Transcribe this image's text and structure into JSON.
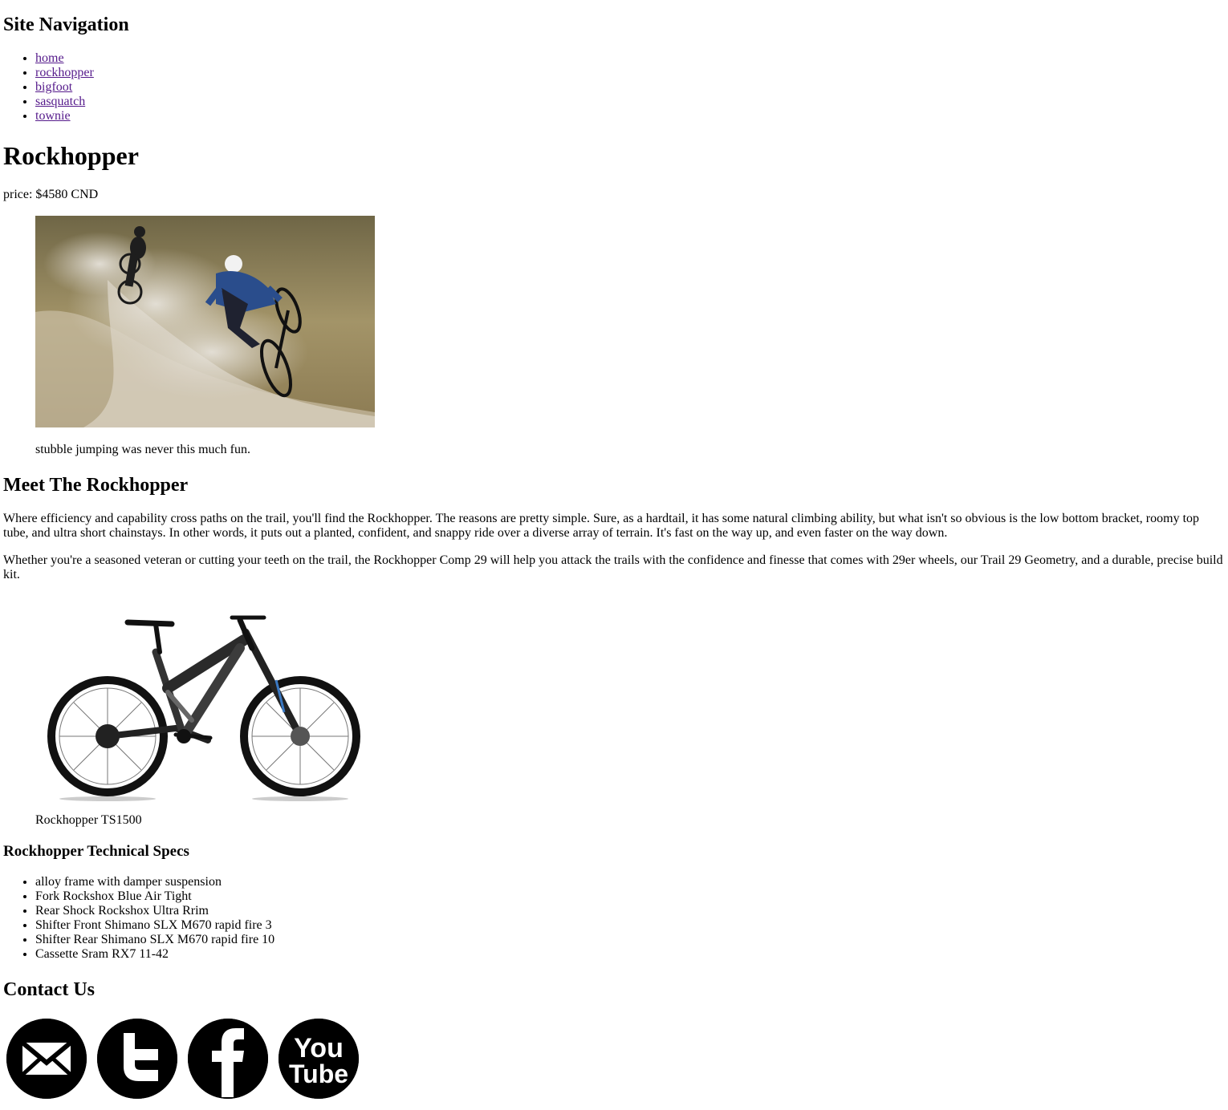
{
  "nav": {
    "title": "Site Navigation",
    "links": [
      "home",
      "rockhopper",
      "bigfoot",
      "sasquatch",
      "townie"
    ]
  },
  "product": {
    "title": "Rockhopper",
    "price": "price: $4580 CND",
    "hero_caption": "stubble jumping was never this much fun.",
    "bike_caption": "Rockhopper TS1500"
  },
  "meet": {
    "title": "Meet The Rockhopper",
    "para1": "Where efficiency and capability cross paths on the trail, you'll find the Rockhopper. The reasons are pretty simple. Sure, as a hardtail, it has some natural climbing ability, but what isn't so obvious is the low bottom bracket, roomy top tube, and ultra short chainstays. In other words, it puts out a planted, confident, and snappy ride over a diverse array of terrain. It's fast on the way up, and even faster on the way down.",
    "para2": "Whether you're a seasoned veteran or cutting your teeth on the trail, the Rockhopper Comp 29 will help you attack the trails with the confidence and finesse that comes with 29er wheels, our Trail 29 Geometry, and a durable, precise build kit."
  },
  "specs": {
    "title": "Rockhopper Technical Specs",
    "items": [
      "alloy frame with damper suspension",
      "Fork Rockshox Blue Air Tight",
      "Rear Shock Rockshox Ultra Rrim",
      "Shifter Front Shimano SLX M670 rapid fire 3",
      "Shifter Rear Shimano SLX M670 rapid fire 10",
      "Cassette Sram RX7 11-42"
    ]
  },
  "contact": {
    "title": "Contact Us",
    "icons": [
      "email-icon",
      "twitter-icon",
      "facebook-icon",
      "youtube-icon"
    ],
    "youtube_top": "You",
    "youtube_bottom": "Tube"
  }
}
